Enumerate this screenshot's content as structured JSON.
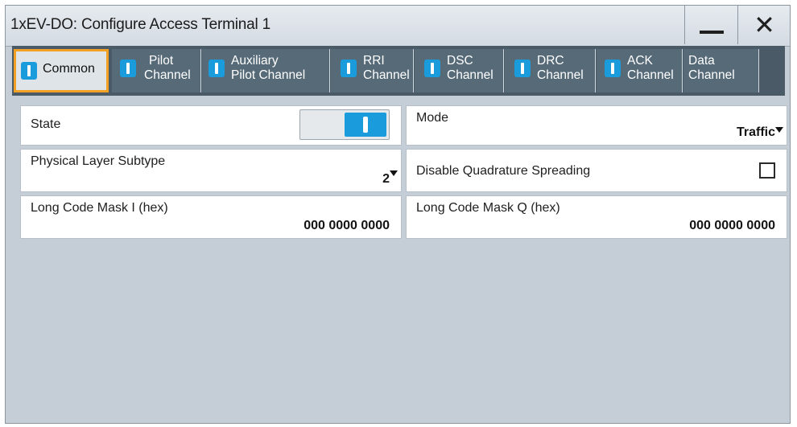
{
  "window": {
    "title": "1xEV-DO: Configure Access Terminal 1",
    "minimize_icon": "minimize-icon",
    "close_icon": "close-icon"
  },
  "tabs": [
    {
      "line1": "Common",
      "line2": "",
      "has_icon": true,
      "active": true
    },
    {
      "line1": "Pilot",
      "line2": "Channel",
      "has_icon": true,
      "active": false
    },
    {
      "line1": "Auxiliary",
      "line2": "Pilot Channel",
      "has_icon": true,
      "active": false
    },
    {
      "line1": "RRI",
      "line2": "Channel",
      "has_icon": true,
      "active": false
    },
    {
      "line1": "DSC",
      "line2": "Channel",
      "has_icon": true,
      "active": false
    },
    {
      "line1": "DRC",
      "line2": "Channel",
      "has_icon": true,
      "active": false
    },
    {
      "line1": "ACK",
      "line2": "Channel",
      "has_icon": true,
      "active": false
    },
    {
      "line1": "Data",
      "line2": "Channel",
      "has_icon": false,
      "active": false
    }
  ],
  "fields": {
    "state": {
      "label": "State",
      "value": "On"
    },
    "mode": {
      "label": "Mode",
      "value": "Traffic"
    },
    "physical_layer_subtype": {
      "label": "Physical Layer Subtype",
      "value": "2"
    },
    "disable_quadrature_spreading": {
      "label": "Disable Quadrature Spreading",
      "checked": false
    },
    "long_code_mask_i": {
      "label": "Long Code Mask I (hex)",
      "value": "000 0000 0000"
    },
    "long_code_mask_q": {
      "label": "Long Code Mask Q (hex)",
      "value": "000 0000 0000"
    }
  },
  "colors": {
    "accent_blue": "#1a9bdc",
    "active_tab_border": "#f2a125",
    "tab_bg": "#566a78",
    "panel_bg": "#c5ced6"
  }
}
